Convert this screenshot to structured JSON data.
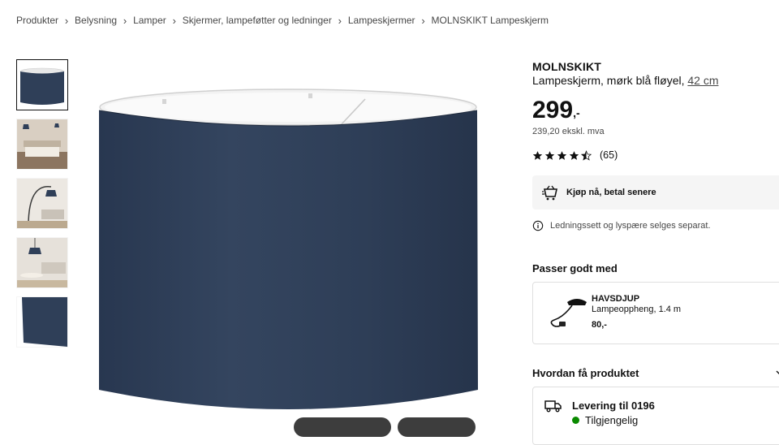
{
  "breadcrumb": {
    "items": [
      "Produkter",
      "Belysning",
      "Lamper",
      "Skjermer, lampeføtter og ledninger",
      "Lampeskjermer",
      "MOLNSKIKT Lampeskjerm"
    ],
    "separator": "›"
  },
  "gallery": {
    "thumbnails": [
      "lampshade-front",
      "bedroom-scene",
      "arc-floor-lamp-scene",
      "living-room-scene",
      "fabric-closeup"
    ],
    "selected_index": 0
  },
  "product": {
    "name": "MOLNSKIKT",
    "description": "Lampeskjerm, mørk blå fløyel,",
    "size_link": "42 cm",
    "price_integer": "299",
    "price_suffix": ",-",
    "price_ex_vat": "239,20 ekskl. mva",
    "rating_value": 4.5,
    "rating_count": "(65)",
    "shade_color": "#2f3f58"
  },
  "payment": {
    "label": "Kjøp nå, betal senere",
    "icon": "klarna-icon"
  },
  "notice": {
    "icon": "info-icon",
    "text": "Ledningssett og lyspære selges separat."
  },
  "pairs_with": {
    "title": "Passer godt med",
    "item": {
      "name": "HAVSDJUP",
      "description": "Lampeoppheng, 1.4 m",
      "price": "80,-"
    }
  },
  "delivery": {
    "section_title": "Hvordan få produktet",
    "title": "Levering til 0196",
    "status": "Tilgjengelig",
    "status_color": "#0a8a00"
  }
}
